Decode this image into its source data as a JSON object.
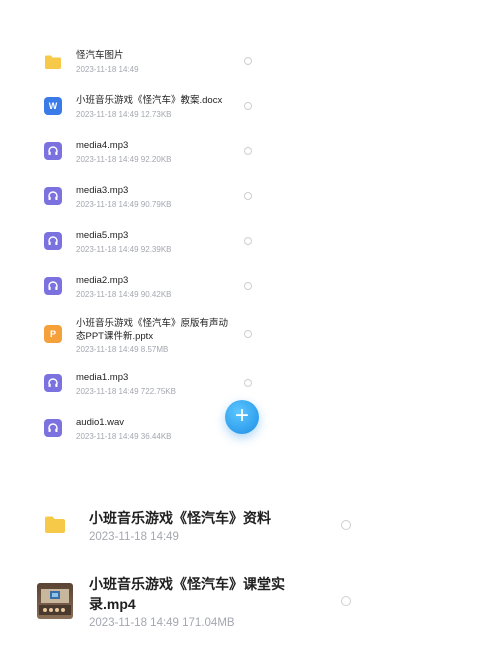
{
  "files": [
    {
      "name": "怪汽车图片",
      "meta": "2023-11-18  14:49",
      "icon": "folder-icon"
    },
    {
      "name": "小班音乐游戏《怪汽车》教案.docx",
      "meta": "2023-11-18  14:49   12.73KB",
      "icon": "word-doc-icon",
      "badge": "W"
    },
    {
      "name": "media4.mp3",
      "meta": "2023-11-18  14:49   92.20KB",
      "icon": "audio-file-icon"
    },
    {
      "name": "media3.mp3",
      "meta": "2023-11-18  14:49   90.79KB",
      "icon": "audio-file-icon"
    },
    {
      "name": "media5.mp3",
      "meta": "2023-11-18  14:49   92.39KB",
      "icon": "audio-file-icon"
    },
    {
      "name": "media2.mp3",
      "meta": "2023-11-18  14:49   90.42KB",
      "icon": "audio-file-icon"
    },
    {
      "name": "小班音乐游戏《怪汽车》原版有声动态PPT课件新.pptx",
      "meta": "2023-11-18  14:49   8.57MB",
      "icon": "ppt-file-icon",
      "badge": "P"
    },
    {
      "name": "media1.mp3",
      "meta": "2023-11-18  14:49   722.75KB",
      "icon": "audio-file-icon"
    },
    {
      "name": "audio1.wav",
      "meta": "2023-11-18  14:49   36.44KB",
      "icon": "audio-file-icon"
    }
  ],
  "fab": {
    "label": "+"
  },
  "large_files": [
    {
      "name": "小班音乐游戏《怪汽车》资料",
      "meta": "2023-11-18  14:49",
      "icon": "folder-icon"
    },
    {
      "name": "小班音乐游戏《怪汽车》课堂实录.mp4",
      "meta": "2023-11-18  14:49   171.04MB",
      "icon": "video-thumbnail"
    }
  ],
  "colors": {
    "folder": "#f7c948",
    "word": "#3b7be8",
    "audio": "#7b72e0",
    "ppt": "#f5a13b",
    "fab": "#1e8de6",
    "meta_text": "#a3a7b0"
  }
}
